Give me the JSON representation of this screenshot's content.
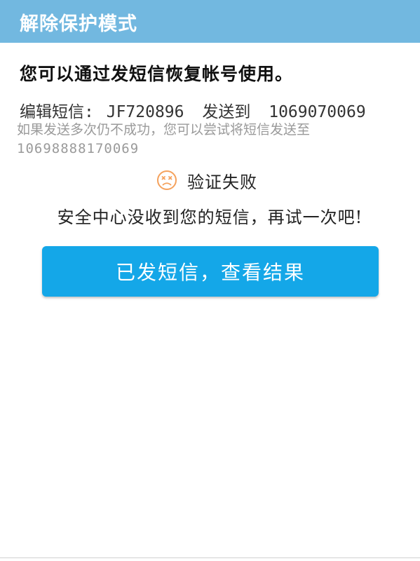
{
  "header": {
    "title": "解除保护模式"
  },
  "content": {
    "intro": "您可以通过发短信恢复帐号使用。",
    "sms": {
      "label": "编辑短信:",
      "code": "JF720896",
      "send_to_label": "发送到",
      "number": "1069070069"
    },
    "hint": {
      "text": "如果发送多次仍不成功，您可以尝试将短信发送至",
      "alt_number": "10698888170069"
    },
    "status": {
      "icon": "sad-face-icon",
      "icon_color": "#f5a25d",
      "title": "验证失败",
      "message": "安全中心没收到您的短信，再试一次吧!"
    },
    "button": {
      "label": "已发短信，查看结果",
      "color": "#14a7e8"
    }
  },
  "colors": {
    "header_bg": "#72b8e0",
    "hint_text": "#9a9a9a"
  }
}
